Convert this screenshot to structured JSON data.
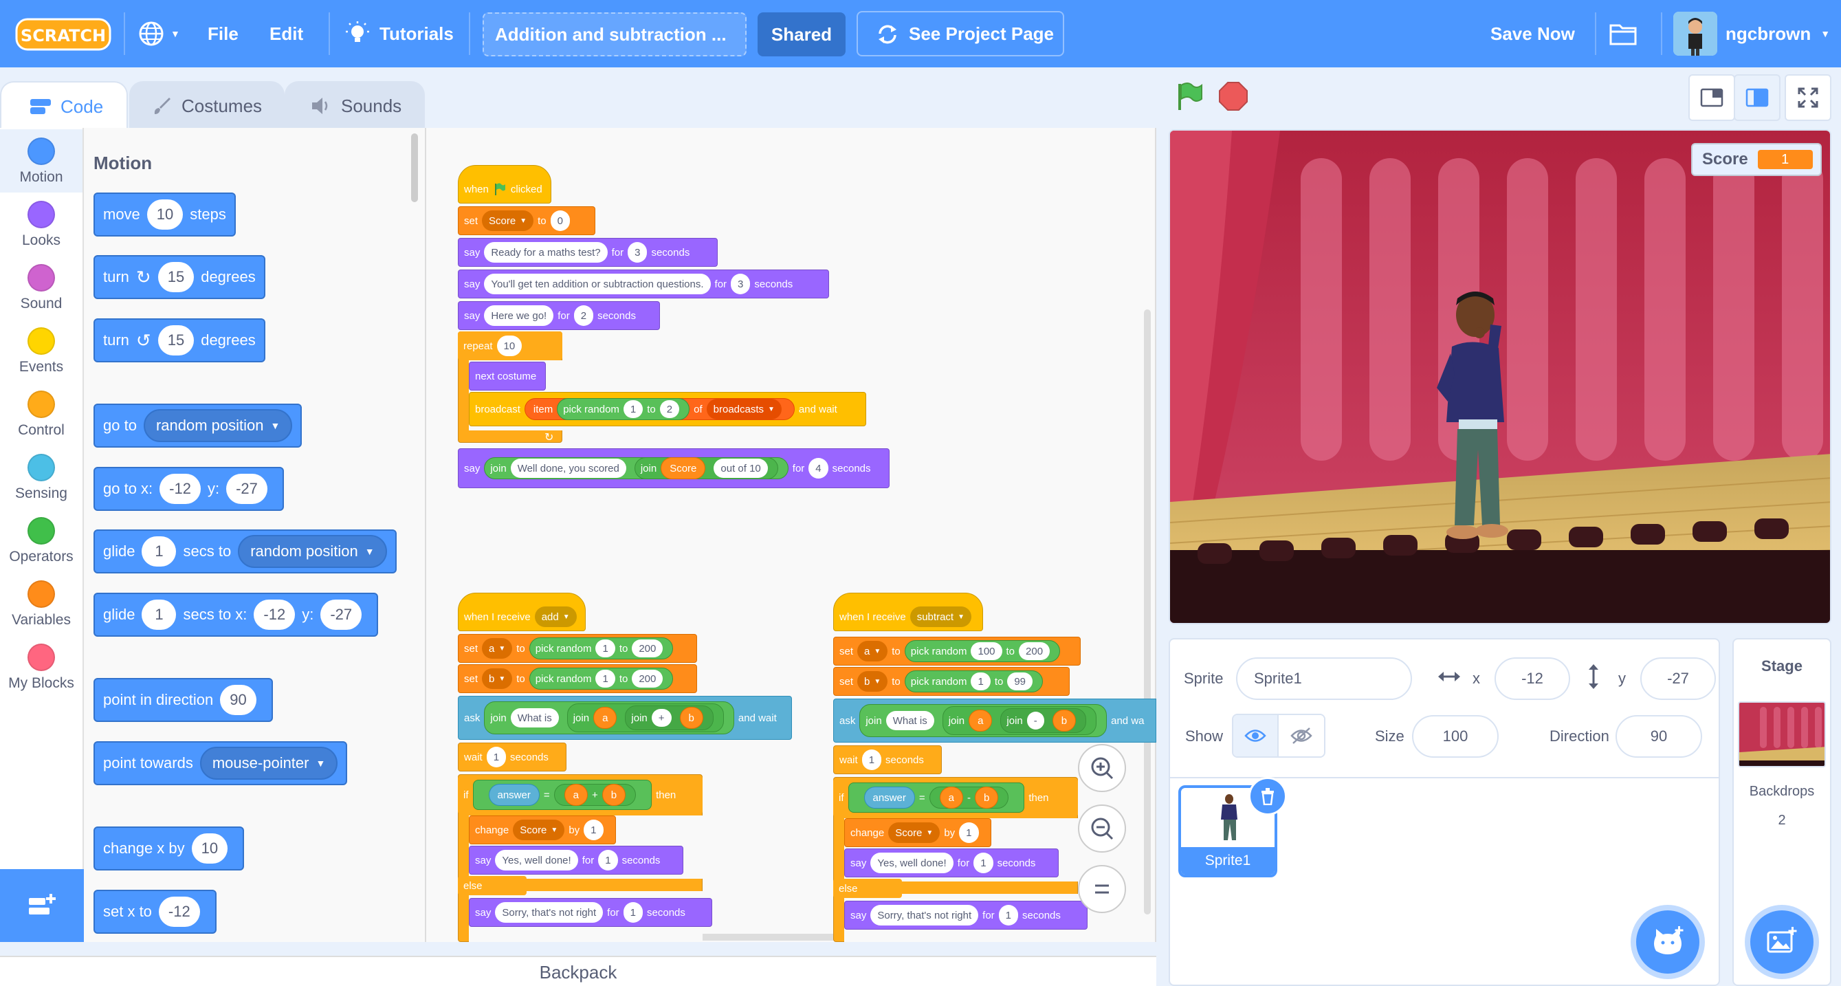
{
  "menu": {
    "logo_text": "SCRATCH",
    "file": "File",
    "edit": "Edit",
    "tutorials": "Tutorials",
    "project_title": "Addition and subtraction ...",
    "shared": "Shared",
    "see_project_page": "See Project Page",
    "save_now": "Save Now",
    "username": "ngcbrown"
  },
  "tabs": {
    "code": "Code",
    "costumes": "Costumes",
    "sounds": "Sounds"
  },
  "categories": [
    {
      "label": "Motion",
      "color": "#4c97ff"
    },
    {
      "label": "Looks",
      "color": "#9966ff"
    },
    {
      "label": "Sound",
      "color": "#cf63cf"
    },
    {
      "label": "Events",
      "color": "#ffd500"
    },
    {
      "label": "Control",
      "color": "#ffab19"
    },
    {
      "label": "Sensing",
      "color": "#4cbfe6"
    },
    {
      "label": "Operators",
      "color": "#40bf4a"
    },
    {
      "label": "Variables",
      "color": "#ff8c1a"
    },
    {
      "label": "My Blocks",
      "color": "#ff6680"
    }
  ],
  "palette": {
    "title": "Motion",
    "move": {
      "a": "move",
      "v": "10",
      "b": "steps"
    },
    "turn_cw": {
      "a": "turn",
      "v": "15",
      "b": "degrees"
    },
    "turn_ccw": {
      "a": "turn",
      "v": "15",
      "b": "degrees"
    },
    "goto": {
      "a": "go to",
      "d": "random position"
    },
    "gotoxy": {
      "a": "go to x:",
      "x": "-12",
      "b": "y:",
      "y": "-27"
    },
    "glide": {
      "a": "glide",
      "v": "1",
      "b": "secs to",
      "d": "random position"
    },
    "glidexy": {
      "a": "glide",
      "v": "1",
      "b": "secs to x:",
      "x": "-12",
      "c": "y:",
      "y": "-27"
    },
    "pointdir": {
      "a": "point in direction",
      "v": "90"
    },
    "pointtow": {
      "a": "point towards",
      "d": "mouse-pointer"
    },
    "changex": {
      "a": "change x by",
      "v": "10"
    },
    "setx": {
      "a": "set x to",
      "v": "-12"
    }
  },
  "script1": {
    "when": "when",
    "clicked": "clicked",
    "set": "set",
    "score_var": "Score",
    "to": "to",
    "zero": "0",
    "say": "say",
    "msg1": "Ready for a maths test?",
    "for": "for",
    "n3": "3",
    "seconds": "seconds",
    "msg2": "You'll get ten addition or subtraction questions.",
    "n3b": "3",
    "msg3": "Here we go!",
    "n2": "2",
    "repeat": "repeat",
    "n10": "10",
    "next_costume": "next costume",
    "broadcast": "broadcast",
    "item": "item",
    "pick_random": "pick random",
    "r1": "1",
    "r2": "2",
    "of": "of",
    "broadcasts": "broadcasts",
    "and_wait": "and wait",
    "join": "join",
    "well_done": "Well done, you scored",
    "score": "Score",
    "out_of": "out of 10",
    "n4": "4"
  },
  "script2": {
    "when_receive": "when I receive",
    "msg": "add",
    "set": "set",
    "a": "a",
    "b": "b",
    "to": "to",
    "pick_random": "pick random",
    "a_lo": "1",
    "a_hi": "200",
    "b_lo": "1",
    "b_hi": "200",
    "ask": "ask",
    "join": "join",
    "what_is": "What is",
    "op": "+",
    "and_wait": "and wait",
    "wait": "wait",
    "wait_n": "1",
    "seconds": "seconds",
    "if": "if",
    "answer": "answer",
    "eq": "=",
    "then": "then",
    "change": "change",
    "score": "Score",
    "by": "by",
    "by_n": "1",
    "say": "say",
    "yes": "Yes, well done!",
    "for": "for",
    "n1": "1",
    "else": "else",
    "sorry": "Sorry, that's not right",
    "n1b": "1"
  },
  "script3": {
    "when_receive": "when I receive",
    "msg": "subtract",
    "set": "set",
    "a": "a",
    "b": "b",
    "to": "to",
    "pick_random": "pick random",
    "a_lo": "100",
    "a_hi": "200",
    "b_lo": "1",
    "b_hi": "99",
    "ask": "ask",
    "join": "join",
    "what_is": "What is",
    "op": "-",
    "and_wait": "and wa",
    "wait": "wait",
    "wait_n": "1",
    "seconds": "seconds",
    "if": "if",
    "answer": "answer",
    "eq": "=",
    "then": "then",
    "change": "change",
    "score": "Score",
    "by": "by",
    "by_n": "1",
    "say": "say",
    "yes": "Yes, well done!",
    "for": "for",
    "n1": "1",
    "else": "else",
    "sorry": "Sorry, that's not right",
    "n1b": "1"
  },
  "backpack": "Backpack",
  "stage": {
    "monitor_label": "Score",
    "monitor_value": "1"
  },
  "sprite_info": {
    "sprite_label": "Sprite",
    "sprite_name": "Sprite1",
    "x_label": "x",
    "x": "-12",
    "y_label": "y",
    "y": "-27",
    "show_label": "Show",
    "size_label": "Size",
    "size": "100",
    "direction_label": "Direction",
    "direction": "90",
    "thumb_name": "Sprite1"
  },
  "stage_pane": {
    "title": "Stage",
    "backdrops_label": "Backdrops",
    "backdrops_count": "2"
  }
}
